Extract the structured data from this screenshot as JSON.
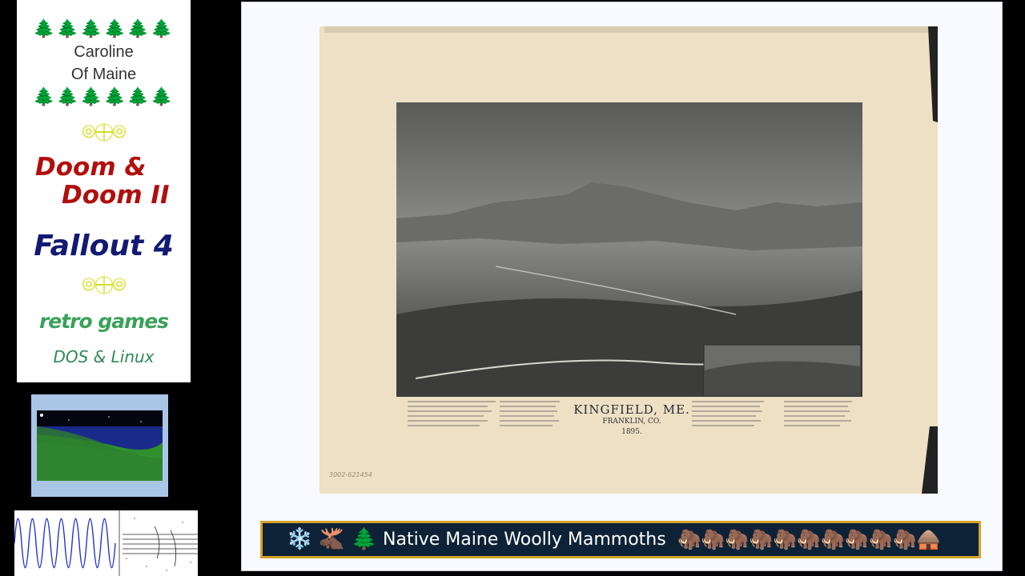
{
  "sidebar": {
    "trees_top": "🌲🌲🌲🌲🌲🌲",
    "name_line1": "Caroline",
    "name_line2": "Of Maine",
    "trees_bottom": "🌲🌲🌲🌲🌲🌲",
    "rings": "⦾⨁⦾",
    "doom_line1": "Doom &",
    "doom_line2": "Doom II",
    "fallout": "Fallout 4",
    "retro": "retro games",
    "dos_linux": "DOS & Linux"
  },
  "map": {
    "title": "KINGFIELD, ME.",
    "subtitle": "FRANKLIN, CO.",
    "year": "1895.",
    "archive_id": "3002-621454"
  },
  "banner": {
    "left_icons": "❄️🫎🌲",
    "text": "Native Maine Woolly Mammoths",
    "right_icons": "🦣🦣🦣🦣🦣🦣🦣🦣🦣🦣🛖"
  },
  "colors": {
    "doom": "#b10e0e",
    "fallout": "#121a72",
    "retro": "#3aa15a",
    "banner_bg": "#0d2236",
    "banner_border": "#d4a22a"
  }
}
